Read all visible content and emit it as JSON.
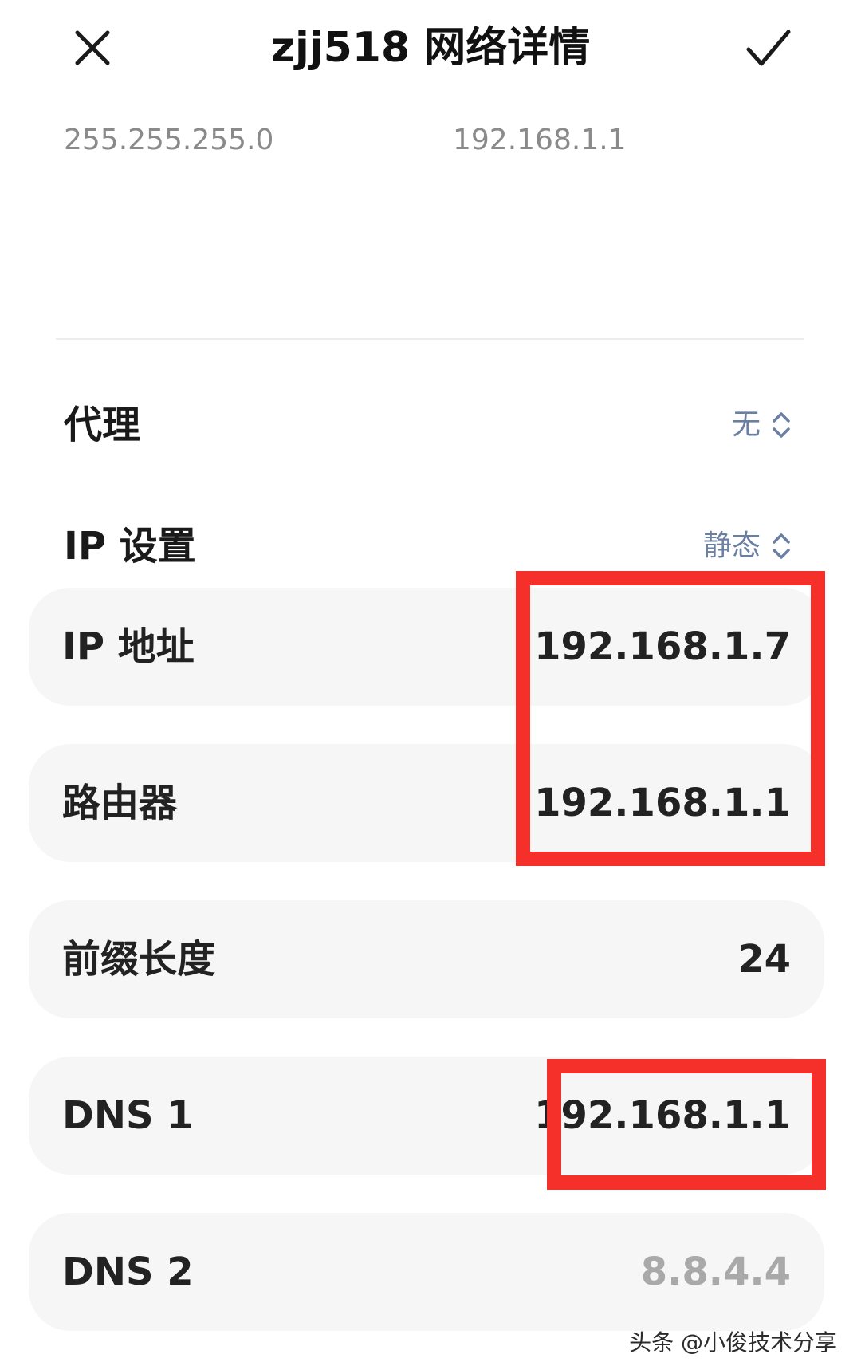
{
  "header": {
    "title": "zjj518 网络详情"
  },
  "previous_section": {
    "netmask": "255.255.255.0",
    "gateway": "192.168.1.1"
  },
  "proxy": {
    "label": "代理",
    "value": "无"
  },
  "ip_settings": {
    "label": "IP 设置",
    "value": "静态"
  },
  "fields": {
    "ip_address": {
      "label": "IP 地址",
      "value": "192.168.1.7"
    },
    "router": {
      "label": "路由器",
      "value": "192.168.1.1"
    },
    "prefix_length": {
      "label": "前缀长度",
      "value": "24"
    },
    "dns1": {
      "label": "DNS 1",
      "value": "192.168.1.1"
    },
    "dns2": {
      "label": "DNS 2",
      "placeholder": "8.8.4.4"
    }
  },
  "watermark": "头条 @小俊技术分享",
  "colors": {
    "highlight": "#f5302a",
    "select_value": "#6b7fa3",
    "card_background": "#f6f6f6"
  },
  "icons": {
    "close": "close-icon",
    "confirm": "checkmark-icon",
    "select": "chevron-up-down-icon"
  }
}
